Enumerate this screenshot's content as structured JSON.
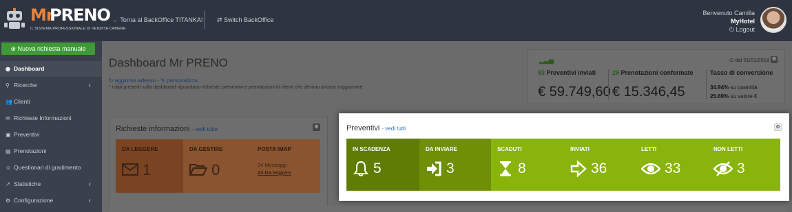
{
  "header": {
    "logo": {
      "mr": "Mr",
      "preno": "PRENO",
      "tagline": "IL SISTEMA PROFESSIONALE DI VENDITA CAMERE"
    },
    "back_link": "← Torna al BackOffice TITANKA!",
    "switch_link": "⇄ Switch BackOffice",
    "user": {
      "greeting": "Benvenuto Camilla",
      "hotel": "MyHotel",
      "logout": "⏻ Logout"
    }
  },
  "sidebar": {
    "new_request": "⊕ Nuova richiesta manuale",
    "items": [
      {
        "label": "Dashboard",
        "icon": "dashboard-icon",
        "glyph": "◉",
        "chevron": ""
      },
      {
        "label": "Ricerche",
        "icon": "search-icon",
        "glyph": "⚲",
        "chevron": "‹"
      },
      {
        "label": "Clienti",
        "icon": "users-icon",
        "glyph": "👥",
        "chevron": ""
      },
      {
        "label": "Richieste Informazioni",
        "icon": "envelope-icon",
        "glyph": "✉",
        "chevron": ""
      },
      {
        "label": "Preventivi",
        "icon": "quote-icon",
        "glyph": "▣",
        "chevron": ""
      },
      {
        "label": "Prenotazioni",
        "icon": "booking-icon",
        "glyph": "▤",
        "chevron": ""
      },
      {
        "label": "Questionari di gradimento",
        "icon": "survey-icon",
        "glyph": "☺",
        "chevron": ""
      },
      {
        "label": "Statistiche",
        "icon": "chart-icon",
        "glyph": "↗",
        "chevron": "‹"
      },
      {
        "label": "Configurazione",
        "icon": "cogs-icon",
        "glyph": "⚙",
        "chevron": "‹"
      }
    ]
  },
  "dashboard": {
    "title": "Dashboard Mr PRENO",
    "refresh": "↻ aggiorna adesso",
    "customize": "✎ personalizza",
    "note": "* i dati presenti sulla dashboard riguardano richieste, preventivi e prenotazioni di clienti che devono ancora soggiornare"
  },
  "stats": {
    "since": "⊙ dal 01/01/2018",
    "quotes_sent": {
      "count": "83",
      "label": "Preventivi inviati",
      "value": "€ 59.749,60"
    },
    "bookings": {
      "count": "29",
      "label": "Prenotazioni confermate",
      "value": "€ 15.346,45"
    },
    "conversion": {
      "label": "Tasso di conversione",
      "qty_pct": "34.94%",
      "qty_label": "su quantità",
      "val_pct": "25.69%",
      "val_label": "su valore €"
    }
  },
  "richieste": {
    "title": "Richieste informazioni",
    "link": "- vedi tutte",
    "tiles": [
      {
        "label": "DA LEGGERE",
        "value": "1",
        "color": "#7a4423",
        "icon": "envelope-icon"
      },
      {
        "label": "DA GESTIRE",
        "value": "0",
        "color": "#8a5430",
        "icon": "folder-open-icon"
      },
      {
        "label": "POSTA IMAP",
        "messages": "24 Messaggi",
        "unread": "24 Da leggere",
        "color": "#8a5430"
      }
    ]
  },
  "preventivi": {
    "title": "Preventivi",
    "link": "- vedi tutti",
    "tiles": [
      {
        "label": "IN SCADENZA",
        "value": "5",
        "color": "#5f7d05",
        "icon": "bell-icon"
      },
      {
        "label": "DA INVIARE",
        "value": "3",
        "color": "#6f8f07",
        "icon": "sign-in-icon"
      },
      {
        "label": "SCADUTI",
        "value": "8",
        "color": "#88b40b",
        "icon": "hourglass-icon"
      },
      {
        "label": "INVIATI",
        "value": "36",
        "color": "#88b40b",
        "icon": "arrow-right-icon"
      },
      {
        "label": "LETTI",
        "value": "33",
        "color": "#88b40b",
        "icon": "eye-icon"
      },
      {
        "label": "NON LETTI",
        "value": "3",
        "color": "#88b40b",
        "icon": "eye-slash-icon"
      }
    ]
  }
}
